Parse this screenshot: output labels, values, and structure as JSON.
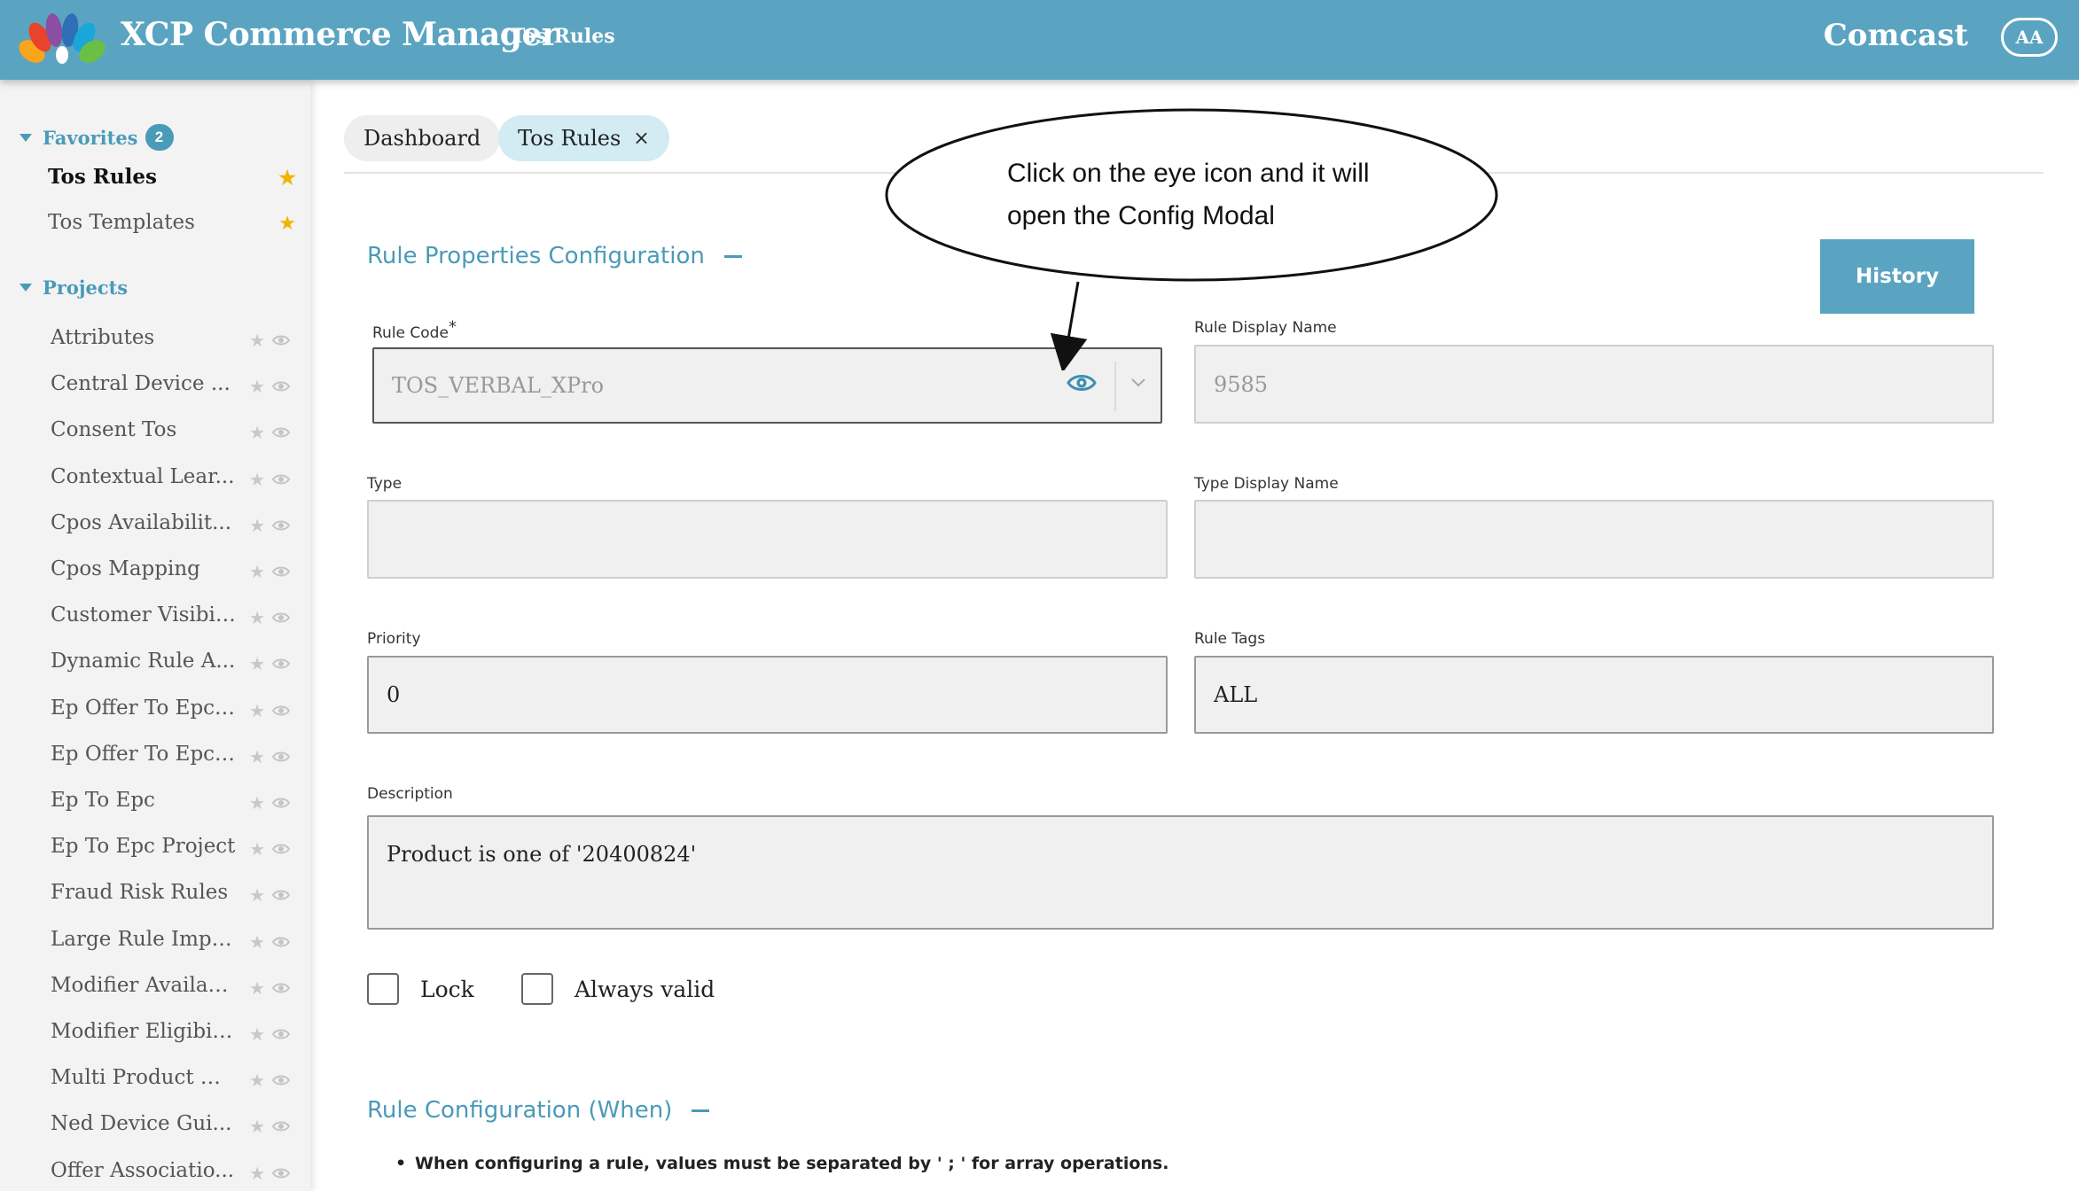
{
  "header": {
    "app_title": "XCP Commerce Manager",
    "breadcrumb": "Tos Rules",
    "brand": "Comcast",
    "avatar_initials": "AA",
    "colors": {
      "bar": "#5ba4c1",
      "accent": "#4a9ab9"
    }
  },
  "sidebar": {
    "favorites": {
      "label": "Favorites",
      "count": "2",
      "items": [
        {
          "label": "Tos Rules",
          "active": true
        },
        {
          "label": "Tos Templates",
          "active": false
        }
      ]
    },
    "projects": {
      "label": "Projects",
      "items": [
        {
          "label": "Attributes"
        },
        {
          "label": "Central Device ..."
        },
        {
          "label": "Consent Tos"
        },
        {
          "label": "Contextual Lear..."
        },
        {
          "label": "Cpos Availabilit..."
        },
        {
          "label": "Cpos Mapping"
        },
        {
          "label": "Customer Visibility"
        },
        {
          "label": "Dynamic Rule A..."
        },
        {
          "label": "Ep Offer To Epc ..."
        },
        {
          "label": "Ep Offer To Epc ..."
        },
        {
          "label": "Ep To Epc"
        },
        {
          "label": "Ep To Epc Project"
        },
        {
          "label": "Fraud Risk Rules"
        },
        {
          "label": "Large Rule Import"
        },
        {
          "label": "Modifier Availab..."
        },
        {
          "label": "Modifier Eligibility"
        },
        {
          "label": "Multi Product Di..."
        },
        {
          "label": "Ned Device Gui..."
        },
        {
          "label": "Offer Associatio..."
        }
      ]
    }
  },
  "tabs": [
    {
      "label": "Dashboard"
    },
    {
      "label": "Tos Rules",
      "close": "×"
    }
  ],
  "form": {
    "section_title": "Rule Properties Configuration",
    "history_label": "History",
    "rule_code": {
      "label": "Rule Code",
      "required": "*",
      "value": "TOS_VERBAL_XPro"
    },
    "rule_display_name": {
      "label": "Rule Display Name",
      "value": "9585"
    },
    "type": {
      "label": "Type",
      "value": ""
    },
    "type_display_name": {
      "label": "Type Display Name",
      "value": ""
    },
    "priority": {
      "label": "Priority",
      "value": "0"
    },
    "rule_tags": {
      "label": "Rule Tags",
      "value": "ALL"
    },
    "description": {
      "label": "Description",
      "value": "Product is one of '20400824'"
    },
    "lock_label": "Lock",
    "always_valid_label": "Always valid"
  },
  "rule_config": {
    "title": "Rule Configuration (When)",
    "hint": "When configuring a rule, values must be separated by ' ; ' for array operations."
  },
  "annotation": {
    "text": "Click on the eye icon and it will open the Config Modal"
  }
}
